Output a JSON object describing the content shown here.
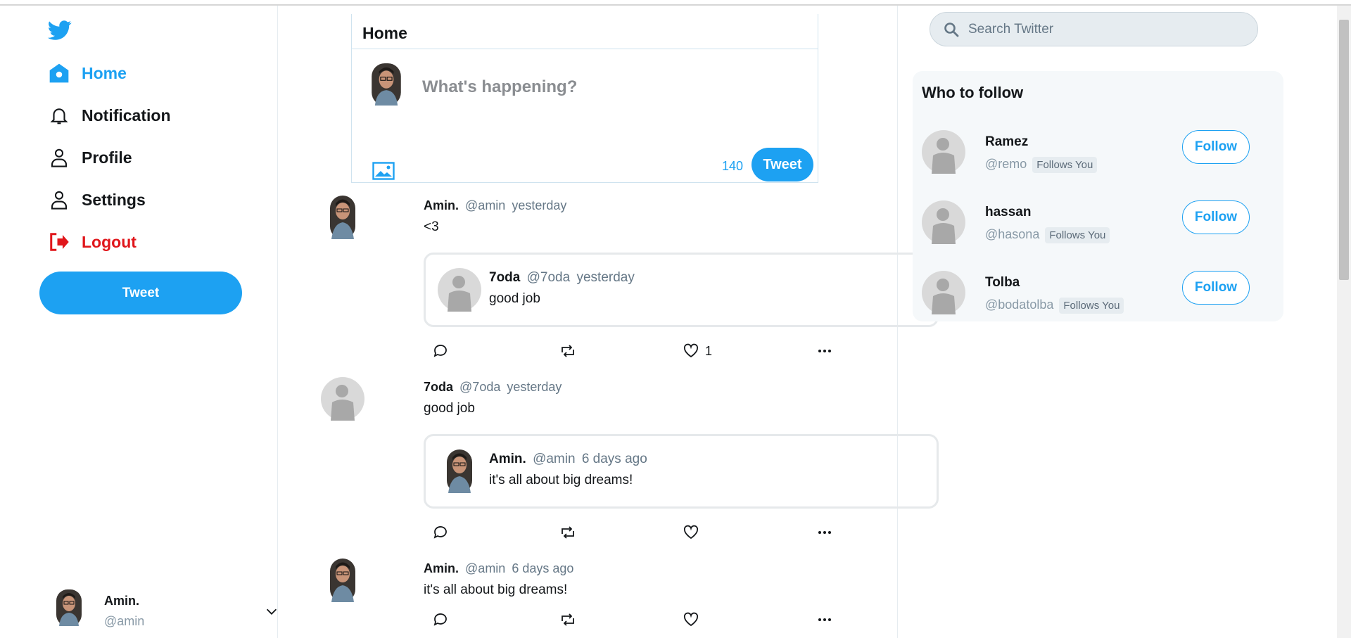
{
  "colors": {
    "accent": "#1da1f2",
    "logout": "#e0161b",
    "muted": "#657786"
  },
  "sidebar": {
    "logo_icon": "twitter-bird-icon",
    "items": [
      {
        "label": "Home",
        "icon": "home-icon",
        "active": true
      },
      {
        "label": "Notification",
        "icon": "bell-icon"
      },
      {
        "label": "Profile",
        "icon": "user-icon"
      },
      {
        "label": "Settings",
        "icon": "user-icon"
      },
      {
        "label": "Logout",
        "icon": "logout-icon"
      }
    ],
    "tweet_button": "Tweet",
    "account": {
      "name": "Amin.",
      "handle": "@amin"
    }
  },
  "composer": {
    "title": "Home",
    "placeholder": "What's happening?",
    "char_count": "140",
    "tweet_button": "Tweet"
  },
  "feed": [
    {
      "name": "Amin.",
      "handle": "@amin",
      "time": "yesterday",
      "text": "<3",
      "avatar": "photo",
      "quote": {
        "name": "7oda",
        "handle": "@7oda",
        "time": "yesterday",
        "text": "good job",
        "avatar": "default"
      },
      "likes": "1"
    },
    {
      "name": "7oda",
      "handle": "@7oda",
      "time": "yesterday",
      "text": "good job",
      "avatar": "default",
      "quote": {
        "name": "Amin.",
        "handle": "@amin",
        "time": "6 days ago",
        "text": "it's all about big dreams!",
        "avatar": "photo"
      },
      "likes": ""
    },
    {
      "name": "Amin.",
      "handle": "@amin",
      "time": "6 days ago",
      "text": "it's all about big dreams!",
      "avatar": "photo",
      "likes": ""
    }
  ],
  "search": {
    "placeholder": "Search Twitter"
  },
  "who_to_follow": {
    "title": "Who to follow",
    "users": [
      {
        "name": "Ramez",
        "handle": "@remo",
        "badge": "Follows You",
        "button": "Follow"
      },
      {
        "name": "hassan",
        "handle": "@hasona",
        "badge": "Follows You",
        "button": "Follow"
      },
      {
        "name": "Tolba",
        "handle": "@bodatolba",
        "badge": "Follows You",
        "button": "Follow"
      }
    ]
  }
}
